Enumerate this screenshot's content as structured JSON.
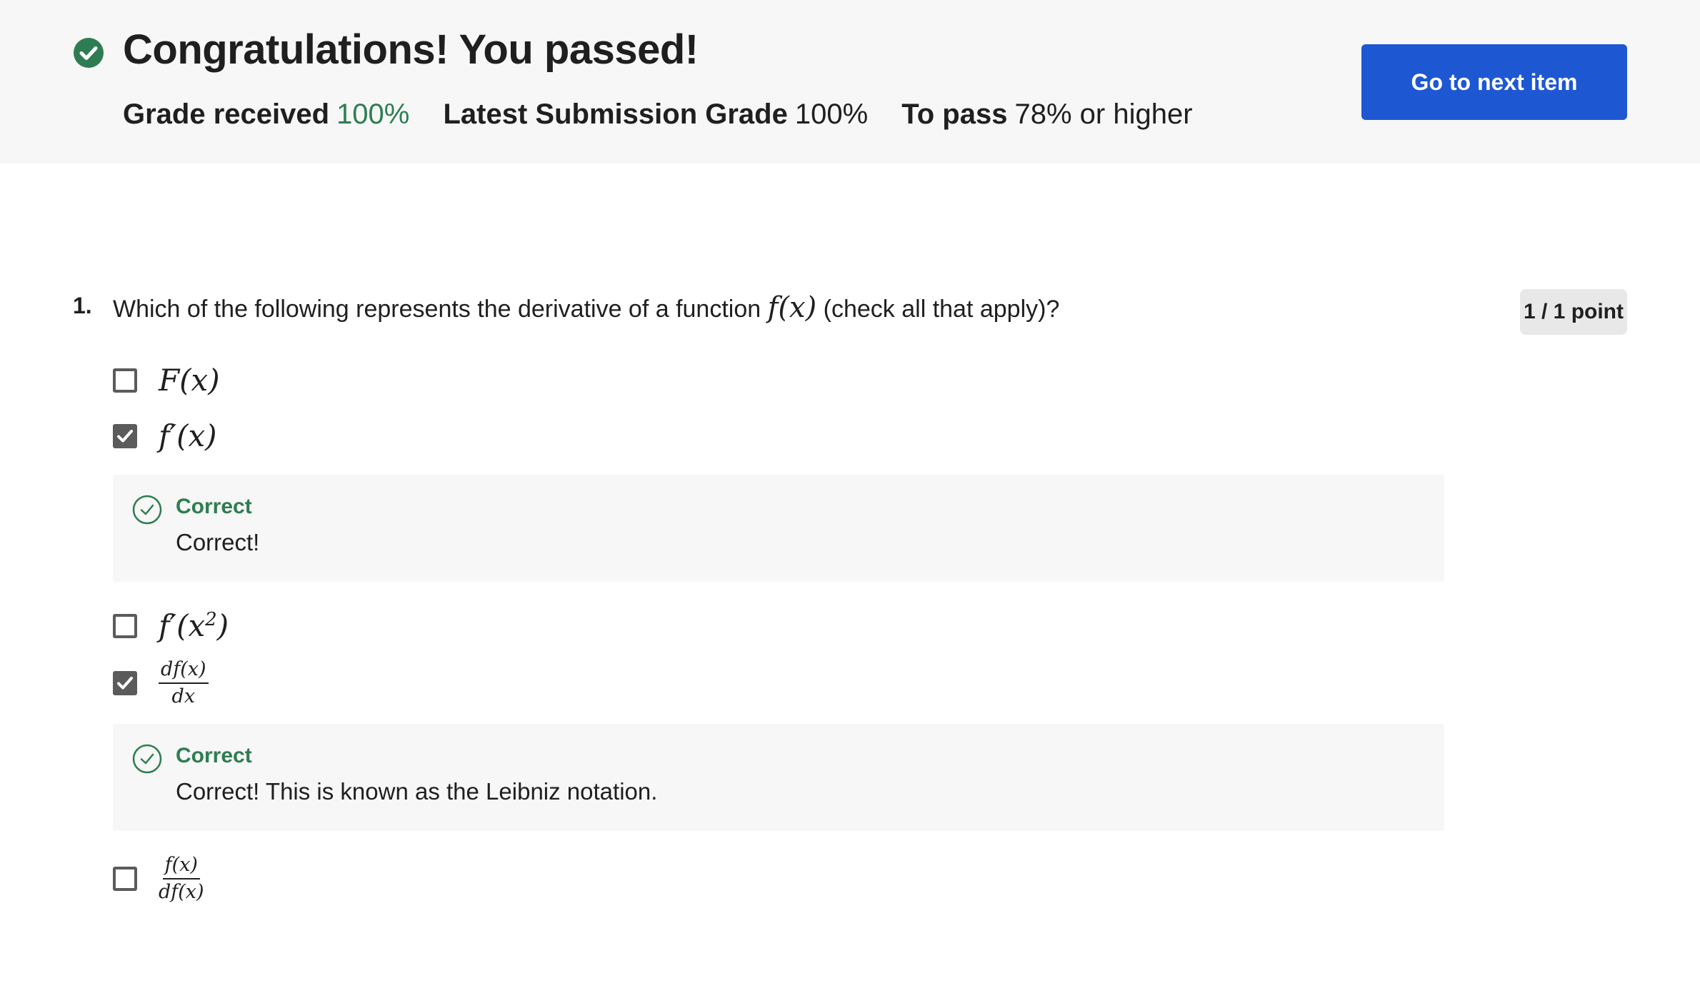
{
  "banner": {
    "title": "Congratulations! You passed!",
    "grade_label": "Grade received",
    "grade_value": "100%",
    "latest_label": "Latest Submission Grade",
    "latest_value": "100%",
    "pass_label": "To pass",
    "pass_value": "78% or higher",
    "next_button": "Go to next item",
    "status_icon": "check-circle-icon"
  },
  "question": {
    "number": "1.",
    "text_before": "Which of the following represents the derivative of a function",
    "math": "f(x)",
    "text_after": "(check all that apply)?",
    "points": "1 / 1 point",
    "options": [
      {
        "label": "F(x)",
        "checked": false
      },
      {
        "label": "f′(x)",
        "checked": true,
        "feedback": {
          "title": "Correct",
          "text": "Correct!"
        }
      },
      {
        "label_base": "f′(x",
        "label_sup": "2",
        "label_end": ")",
        "checked": false
      },
      {
        "numerator": "df(x)",
        "denominator": "dx",
        "checked": true,
        "feedback": {
          "title": "Correct",
          "text": "Correct! This is known as the Leibniz notation."
        }
      },
      {
        "numerator": "f(x)",
        "denominator": "df(x)",
        "checked": false
      }
    ]
  },
  "colors": {
    "accent_green": "#2e7d52",
    "button_blue": "#1e57d2",
    "banner_bg": "#f6f7f6"
  }
}
